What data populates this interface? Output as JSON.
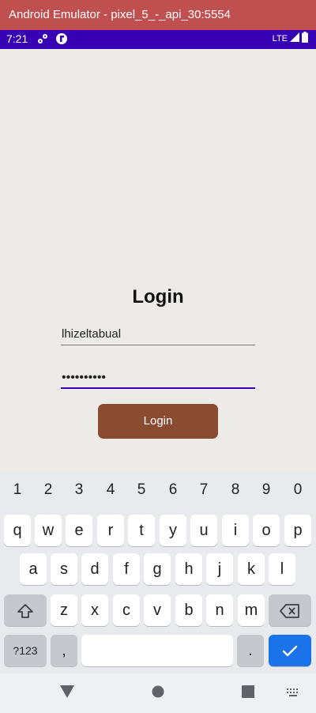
{
  "window": {
    "title": "Android Emulator - pixel_5_-_api_30:5554"
  },
  "status_bar": {
    "time": "7:21",
    "network": "LTE"
  },
  "login": {
    "title": "Login",
    "username_value": "lhizeltabual",
    "password_value": "••••••••••",
    "button_label": "Login"
  },
  "keyboard": {
    "numbers": [
      "1",
      "2",
      "3",
      "4",
      "5",
      "6",
      "7",
      "8",
      "9",
      "0"
    ],
    "row1": [
      "q",
      "w",
      "e",
      "r",
      "t",
      "y",
      "u",
      "i",
      "o",
      "p"
    ],
    "row2": [
      "a",
      "s",
      "d",
      "f",
      "g",
      "h",
      "j",
      "k",
      "l"
    ],
    "row3": [
      "z",
      "x",
      "c",
      "v",
      "b",
      "n",
      "m"
    ],
    "symbols_label": "?123",
    "comma": ",",
    "period": "."
  },
  "colors": {
    "window_bar": "#c0504f",
    "status_bar": "#3700b3",
    "app_background": "#ecebe7",
    "button": "#8a4b30",
    "enter_key": "#1a73e8"
  },
  "icons": [
    "settings-icon",
    "notification-app-icon",
    "signal-icon",
    "battery-icon",
    "shift-icon",
    "backspace-icon",
    "check-icon",
    "back-icon",
    "home-icon",
    "recents-icon",
    "keyboard-switch-icon"
  ]
}
